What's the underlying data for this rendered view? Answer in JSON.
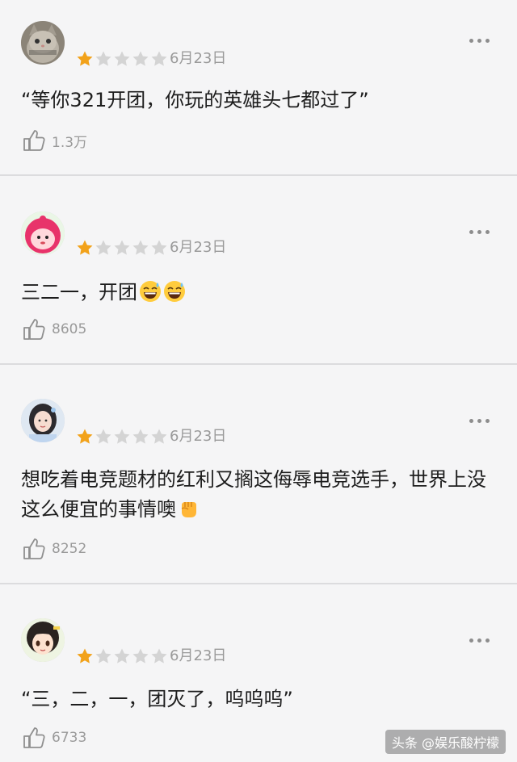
{
  "comments": [
    {
      "avatar_icon": "cat-avatar-icon",
      "rating_filled": 1,
      "rating_total": 5,
      "date": "6月23日",
      "text": "“等你321开团，你玩的英雄头七都过了”",
      "likes": "1.3万"
    },
    {
      "avatar_icon": "cartoon-red-hood-avatar-icon",
      "rating_filled": 1,
      "rating_total": 5,
      "date": "6月23日",
      "text": "三二一，开团",
      "emojis": [
        "grin-sweat-emoji",
        "grin-sweat-emoji"
      ],
      "likes": "8605"
    },
    {
      "avatar_icon": "girl-photo-avatar-icon",
      "rating_filled": 1,
      "rating_total": 5,
      "date": "6月23日",
      "text": "想吃着电竞题材的红利又搁这侮辱电竞选手，世界上没这么便宜的事情噢",
      "emojis": [
        "fist-emoji"
      ],
      "likes": "8252"
    },
    {
      "avatar_icon": "anime-girl-avatar-icon",
      "rating_filled": 1,
      "rating_total": 5,
      "date": "6月23日",
      "text": "“三，二，一，团灭了，呜呜呜”",
      "likes": "6733"
    }
  ],
  "watermark": "头条 @娱乐酸柠檬",
  "colors": {
    "star_filled": "#f2a21a",
    "star_empty": "#d4d4d4",
    "meta_text": "#9a9a9a",
    "background": "#f5f5f6"
  }
}
